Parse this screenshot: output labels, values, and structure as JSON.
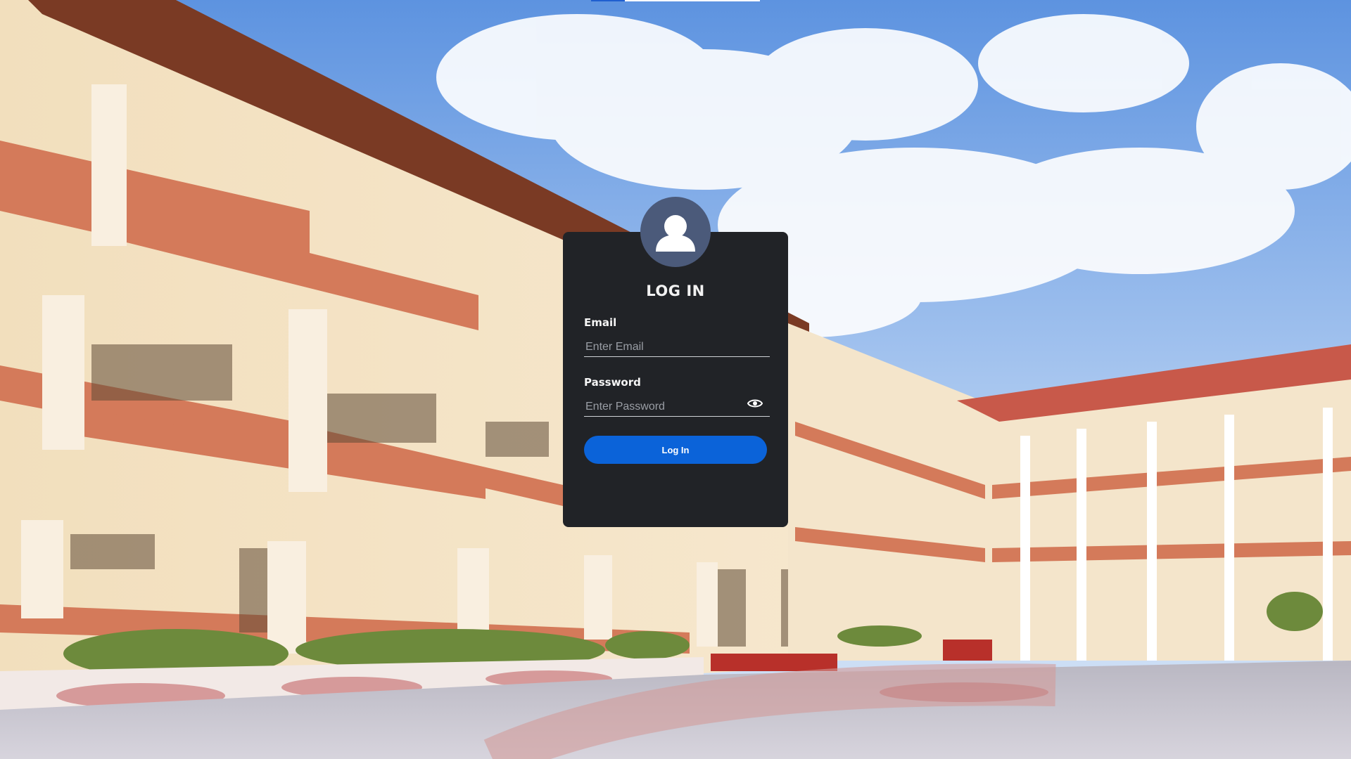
{
  "login": {
    "title": "LOG IN",
    "email_label": "Email",
    "email_placeholder": "Enter Email",
    "email_value": "",
    "password_label": "Password",
    "password_placeholder": "Enter Password",
    "password_value": "",
    "submit_label": "Log In"
  },
  "icons": {
    "avatar": "user-avatar-icon",
    "toggle_password": "eye-icon"
  },
  "colors": {
    "card_bg": "#212327",
    "avatar_bg": "#4b5a7a",
    "button_bg": "#0b63d9",
    "text": "#f2f2f2"
  }
}
